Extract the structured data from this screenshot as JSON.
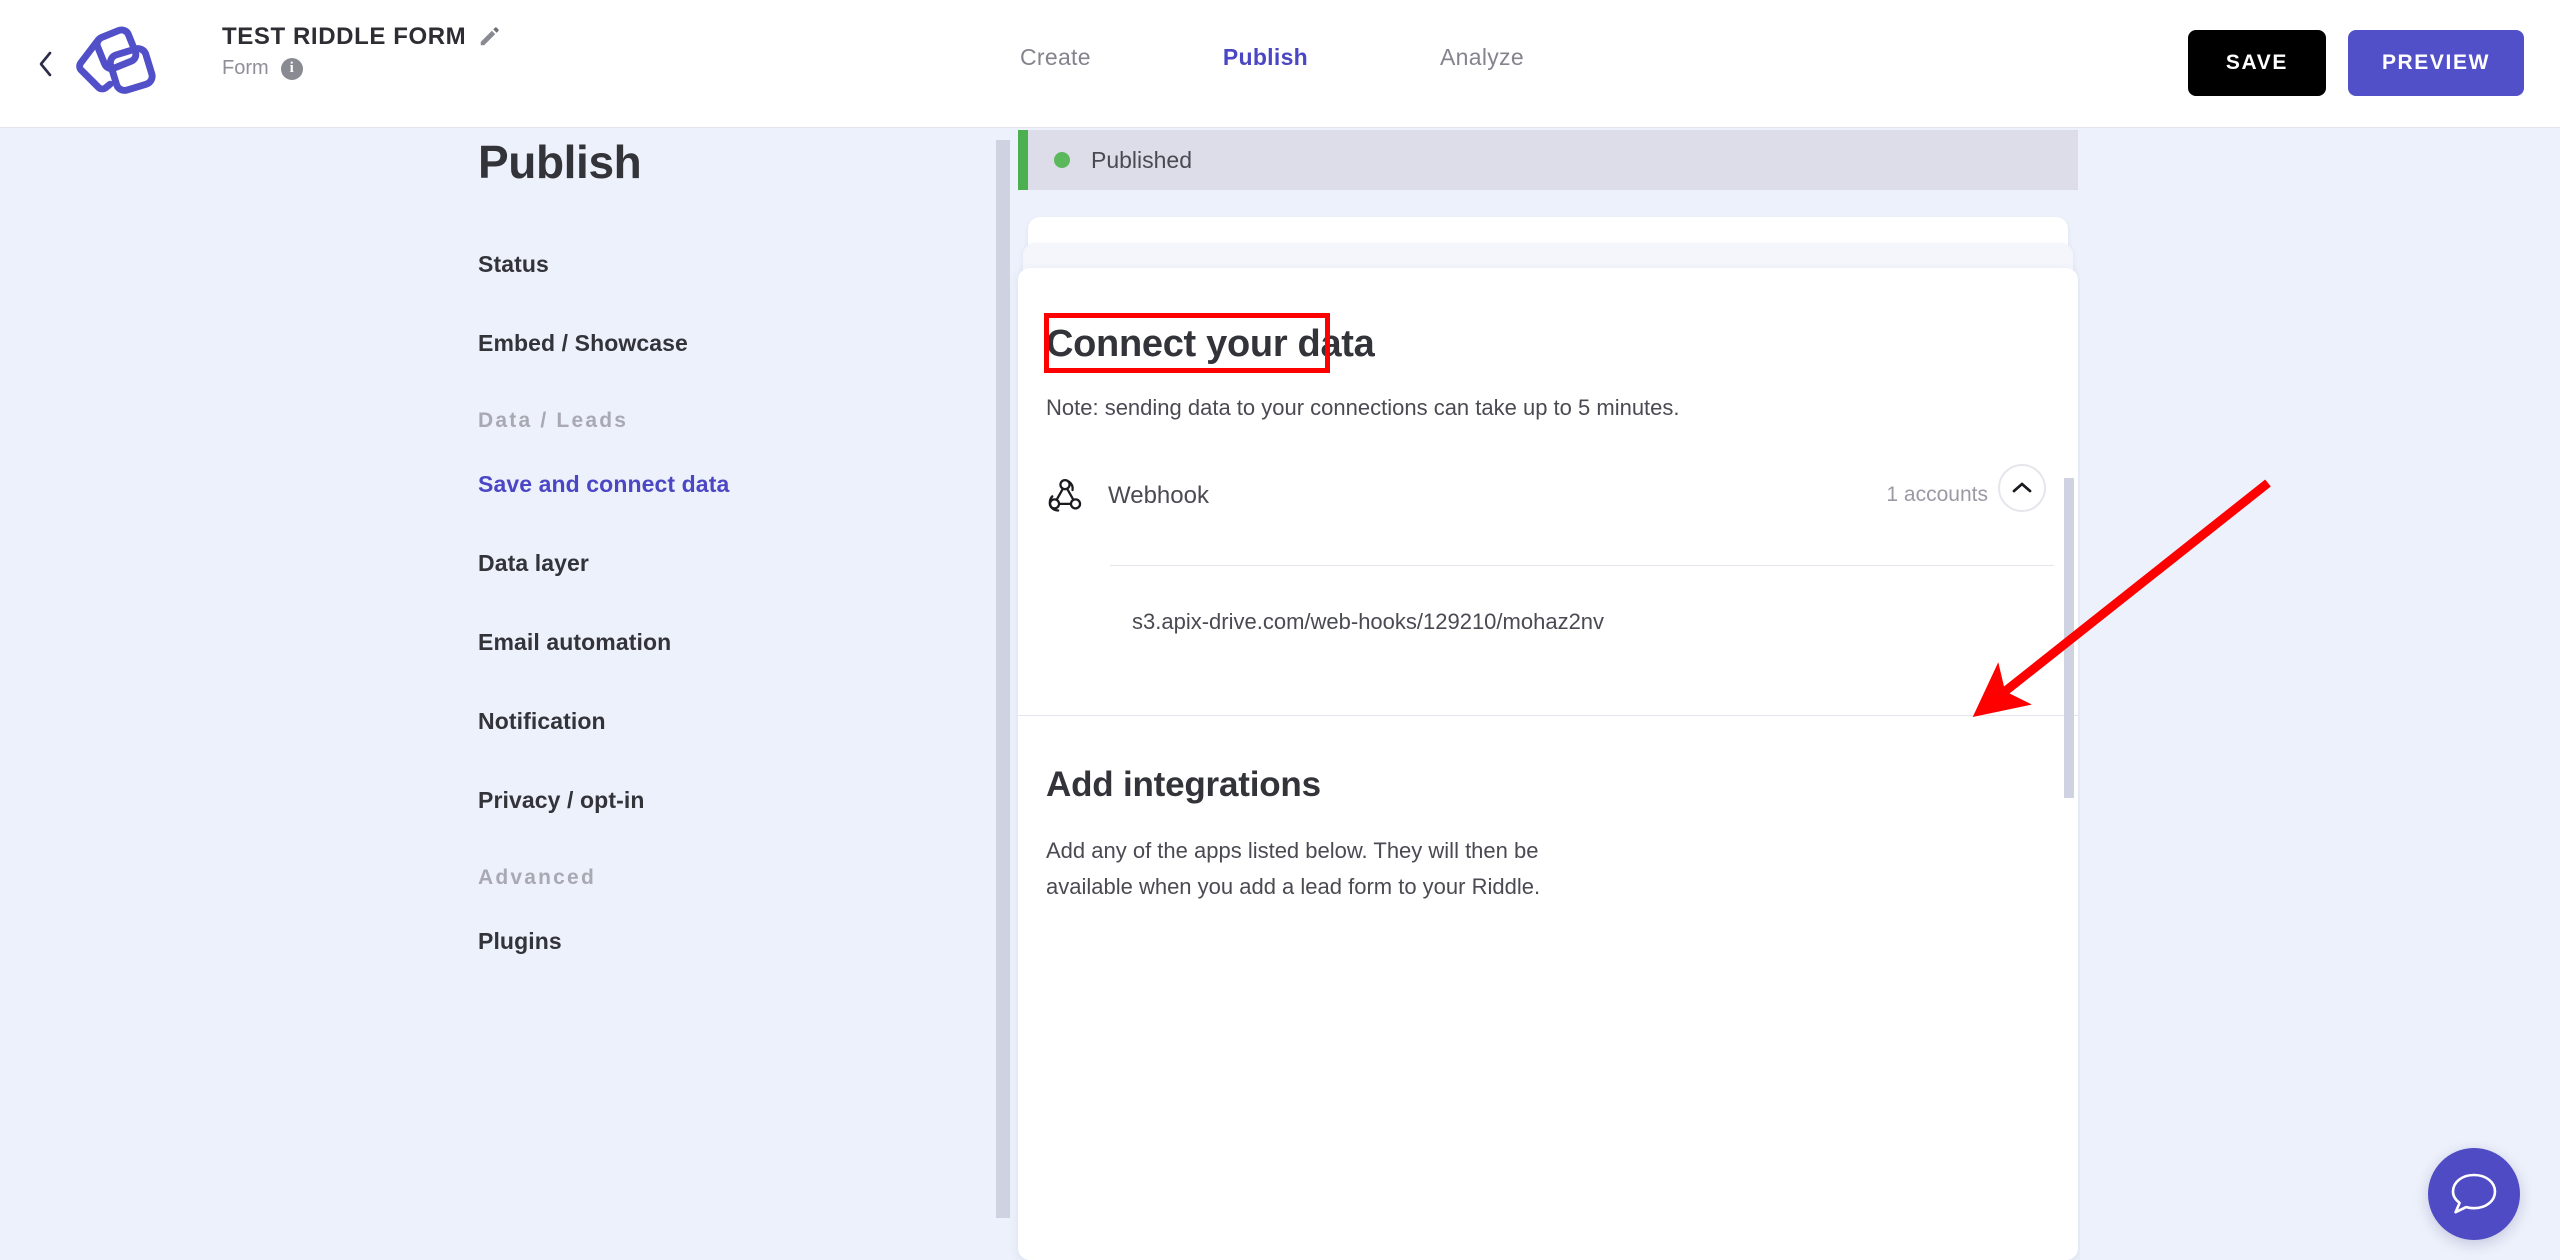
{
  "header": {
    "back_icon": "chevron-left-icon",
    "logo_icon": "riddle-logo-icon",
    "riddle_title": "TEST RIDDLE FORM",
    "edit_icon": "pencil-icon",
    "riddle_type": "Form",
    "info_icon": "info-icon",
    "info_glyph": "i",
    "tabs": [
      {
        "label": "Create",
        "active": false
      },
      {
        "label": "Publish",
        "active": true
      },
      {
        "label": "Analyze",
        "active": false
      }
    ],
    "save_label": "SAVE",
    "preview_label": "PREVIEW",
    "save_bg": "#000000",
    "preview_bg": "#5250c9",
    "accent_color": "#4b47c4"
  },
  "sidebar": {
    "heading": "Publish",
    "items": [
      {
        "label": "Status",
        "type": "item",
        "active": false
      },
      {
        "label": "Embed / Showcase",
        "type": "item",
        "active": false
      },
      {
        "label": "Data / Leads",
        "type": "group"
      },
      {
        "label": "Save and connect data",
        "type": "item",
        "active": true
      },
      {
        "label": "Data layer",
        "type": "item",
        "active": false
      },
      {
        "label": "Email automation",
        "type": "item",
        "active": false
      },
      {
        "label": "Notification",
        "type": "item",
        "active": false
      },
      {
        "label": "Privacy / opt-in",
        "type": "item",
        "active": false
      },
      {
        "label": "Advanced",
        "type": "group"
      },
      {
        "label": "Plugins",
        "type": "item",
        "active": false
      }
    ]
  },
  "main": {
    "status": {
      "label": "Published",
      "dot_color": "#5cb85c",
      "accent_color": "#4caf50",
      "bar_bg": "#dcdde9"
    },
    "connect_section": {
      "title": "Connect your data",
      "note": "Note: sending data to your connections can take up to 5 minutes.",
      "connection": {
        "icon": "webhook-icon",
        "name": "Webhook",
        "accounts_text": "1 accounts",
        "collapse_icon": "chevron-up-icon",
        "accounts": [
          {
            "url": "s3.apix-drive.com/web-hooks/129210/mohaz2nv",
            "enabled": false,
            "toggle_off_color": "#9d9da6",
            "menu_icon": "kebab-menu-icon"
          }
        ]
      }
    },
    "integrations_section": {
      "title": "Add integrations",
      "description": "Add any of the apps listed below. They will then be available when you add a lead form to your Riddle."
    }
  },
  "annotations": {
    "highlight_color": "#ff0000",
    "boxes": [
      {
        "target": "connect-your-data-title"
      },
      {
        "target": "webhook-account-toggle"
      }
    ],
    "arrow": {
      "from": "upper-right",
      "to": "webhook-account-toggle"
    }
  },
  "chat_widget": {
    "icon": "chat-bubble-icon",
    "bg_color": "#4f4bc4"
  }
}
